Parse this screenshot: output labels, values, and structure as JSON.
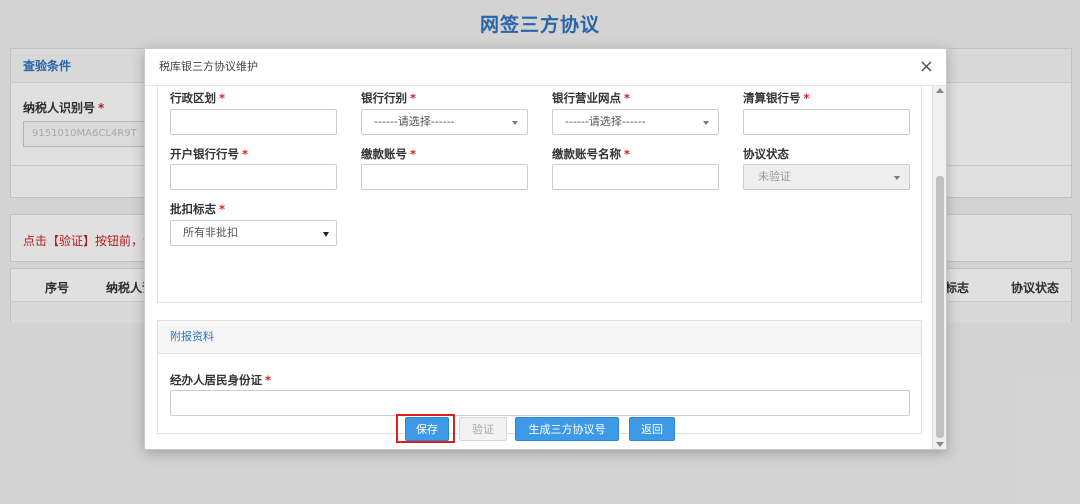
{
  "page": {
    "title": "网签三方协议",
    "query_heading": "查验条件",
    "taxpayer_id_label": "纳税人识别号",
    "taxpayer_id_value": "9151010MA6CL4R9T",
    "note": "点击【验证】按钮前，请",
    "table_headers": [
      "序号",
      "纳税人识",
      "标志",
      "协议状态"
    ]
  },
  "modal": {
    "title": "税库银三方协议维护",
    "close_label": "×",
    "fields": {
      "admin_region": {
        "label": "行政区划",
        "value": ""
      },
      "bank_type": {
        "label": "银行行别",
        "value": "------请选择------"
      },
      "bank_outlet": {
        "label": "银行营业网点",
        "value": "------请选择------"
      },
      "clearing_bank_no": {
        "label": "清算银行号",
        "value": ""
      },
      "open_bank_no": {
        "label": "开户银行行号",
        "value": ""
      },
      "payment_account": {
        "label": "缴款账号",
        "value": ""
      },
      "payment_account_name": {
        "label": "缴款账号名称",
        "value": ""
      },
      "agreement_status": {
        "label": "协议状态",
        "value": "未验证"
      },
      "batch_flag": {
        "label": "批扣标志",
        "value": "所有非批扣"
      }
    },
    "attachments": {
      "heading": "附报资料",
      "agent_id_label": "经办人居民身份证",
      "agent_id_value": ""
    },
    "buttons": {
      "save": "保存",
      "verify": "验证",
      "generate": "生成三方协议号",
      "back": "返回"
    },
    "required_mark": "*"
  },
  "colors": {
    "accent": "#3e9ae6",
    "title_blue": "#2b73c0",
    "required": "#e02020",
    "highlight_border": "#d82020"
  }
}
